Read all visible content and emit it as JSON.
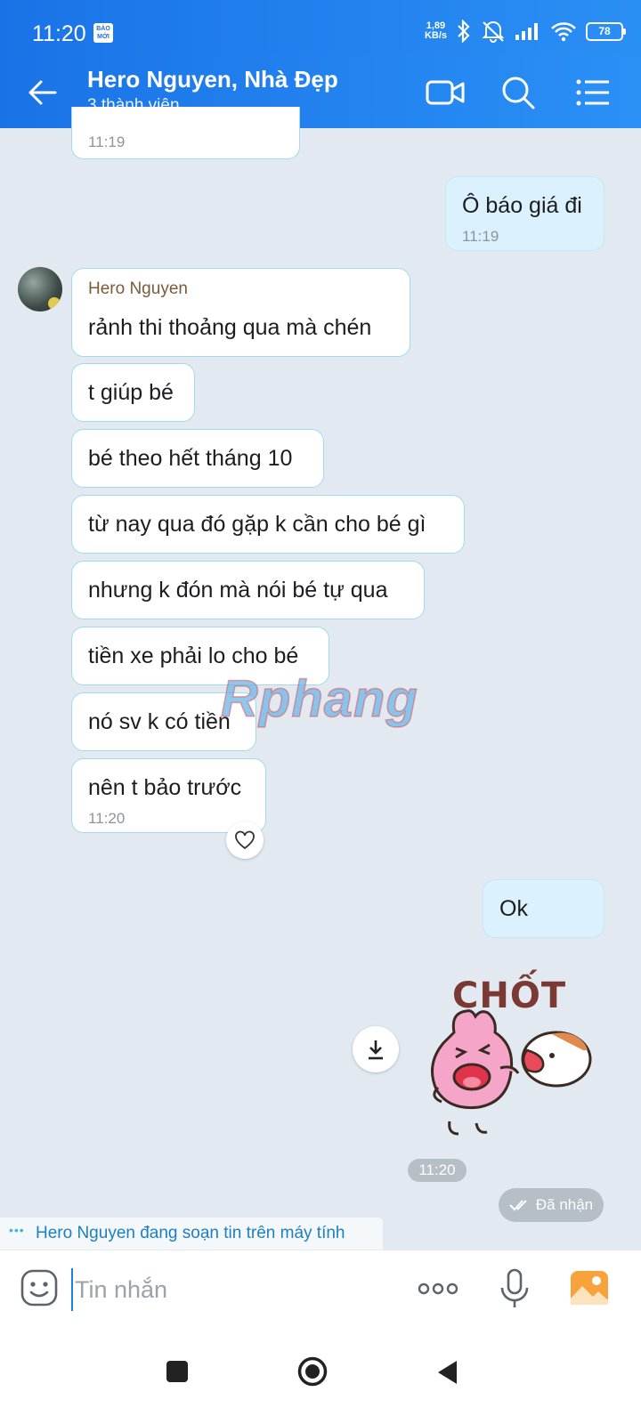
{
  "status": {
    "time": "11:20",
    "news_badge": "BÁO MỚI",
    "net_speed_value": "1,89",
    "net_speed_unit": "KB/s",
    "battery": "78"
  },
  "header": {
    "title": "Hero Nguyen, Nhà Đẹp",
    "subtitle": "3 thành viên"
  },
  "messages": {
    "m0_time": "11:19",
    "m1_text": "Ô báo giá đi",
    "m1_time": "11:19",
    "sender_name": "Hero Nguyen",
    "m2_text": "rảnh thi thoảng qua mà chén",
    "m3_text": "t giúp bé",
    "m4_text": "bé theo hết tháng 10",
    "m5_text": "từ nay qua đó gặp k cần cho bé gì",
    "m6_text": "nhưng k đón mà nói bé tự qua",
    "m7_text": "tiền xe phải lo cho bé",
    "m8_text": "nó sv k có tiền",
    "m9_text": "nên t bảo trước",
    "m9_time": "11:20",
    "m10_text": "Ok",
    "sticker_caption": "CHỐT",
    "sticker_time": "11:20",
    "received_status": "Đã nhận"
  },
  "watermark": "Rphang",
  "typing_indicator": "Hero Nguyen đang soạn tin trên máy tính",
  "composer": {
    "placeholder": "Tin nhắn"
  },
  "colors": {
    "header": "#1a73e6",
    "chat_bg": "#e2e9f1",
    "incoming_bubble_border": "#9fdcec",
    "outgoing_bubble": "#dbf1fd"
  },
  "icons": [
    "back-arrow-icon",
    "video-call-icon",
    "search-icon",
    "menu-list-icon",
    "heart-icon",
    "download-icon",
    "check-icon",
    "emoji-icon",
    "more-icon",
    "mic-icon",
    "image-icon",
    "nav-recent-icon",
    "nav-home-icon",
    "nav-back-icon"
  ]
}
